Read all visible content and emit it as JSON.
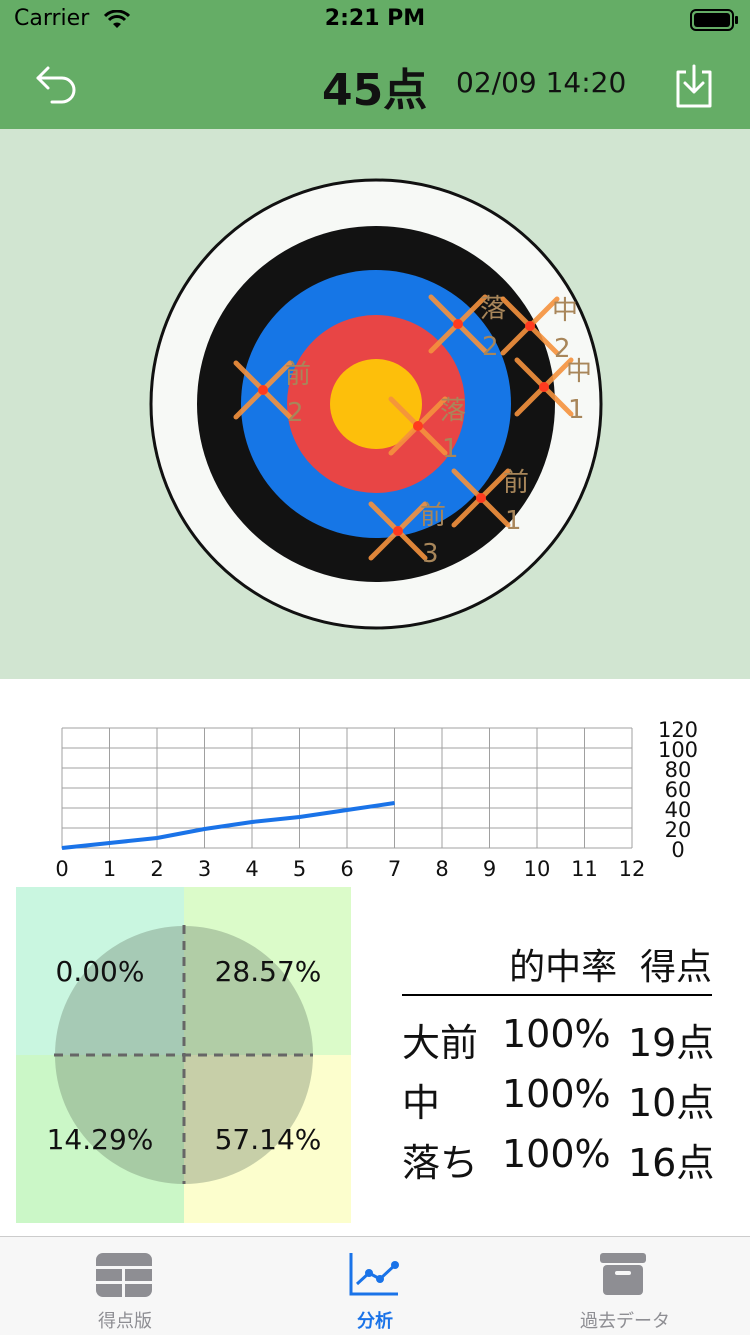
{
  "status_bar": {
    "carrier": "Carrier",
    "time": "2:21 PM"
  },
  "header": {
    "score": "45点",
    "datetime": "02/09 14:20"
  },
  "target": {
    "marks": [
      {
        "label": "落",
        "number": "2"
      },
      {
        "label": "中",
        "number": "2"
      },
      {
        "label": "中",
        "number": "1"
      },
      {
        "label": "前",
        "number": "2"
      },
      {
        "label": "落",
        "number": "1"
      },
      {
        "label": "前",
        "number": "1"
      },
      {
        "label": "前",
        "number": "3"
      }
    ]
  },
  "chart_data": {
    "type": "line",
    "x": [
      0,
      1,
      2,
      3,
      4,
      5,
      6,
      7
    ],
    "series": [
      {
        "values": [
          0,
          5,
          10,
          19,
          26,
          31,
          38,
          45
        ]
      }
    ],
    "x_ticks": [
      "0",
      "1",
      "2",
      "3",
      "4",
      "5",
      "6",
      "7",
      "8",
      "9",
      "10",
      "11",
      "12"
    ],
    "y_ticks": [
      "120",
      "100",
      "80",
      "60",
      "40",
      "20",
      "0"
    ],
    "xlim": [
      0,
      12
    ],
    "ylim": [
      0,
      120
    ],
    "grid": true
  },
  "quadrants": {
    "top_left": "0.00%",
    "top_right": "28.57%",
    "bottom_left": "14.29%",
    "bottom_right": "57.14%"
  },
  "stats": {
    "header": "的中率  得点",
    "rows": [
      {
        "name": "大前",
        "rate": "100%",
        "points": "19点"
      },
      {
        "name": "中",
        "rate": "100%",
        "points": "10点"
      },
      {
        "name": "落ち",
        "rate": "100%",
        "points": "16点"
      }
    ]
  },
  "tabs": [
    {
      "label": "得点版",
      "icon": "grid-icon",
      "active": false
    },
    {
      "label": "分析",
      "icon": "chart-icon",
      "active": true
    },
    {
      "label": "過去データ",
      "icon": "archive-icon",
      "active": false
    }
  ],
  "colors": {
    "header_bg": "#65ad66",
    "target_bg": "#d1e5d1",
    "accent": "#1a73e8",
    "mark": "#f5923e",
    "ring_gold": "#fdbf0b",
    "ring_red": "#e84545",
    "ring_blue": "#1676e6",
    "ring_black": "#121212"
  }
}
